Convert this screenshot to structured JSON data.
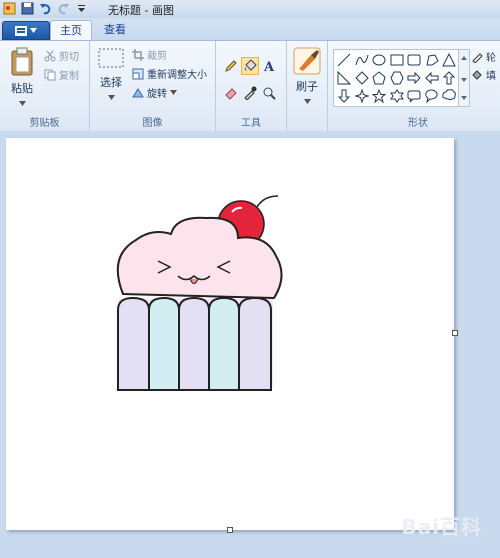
{
  "window": {
    "title": "无标题 - 画图"
  },
  "tabs": {
    "file_icon": "paint-menu-icon",
    "home": "主页",
    "view": "查看"
  },
  "clipboard": {
    "paste": "粘贴",
    "cut": "剪切",
    "copy": "复制",
    "group_label": "剪贴板"
  },
  "image": {
    "select": "选择",
    "crop": "裁剪",
    "resize": "重新调整大小",
    "rotate": "旋转",
    "group_label": "图像"
  },
  "tools": {
    "group_label": "工具"
  },
  "brushes": {
    "label": "刷子"
  },
  "shapes": {
    "group_label": "形状",
    "outline": "轮",
    "fill": "填"
  },
  "watermark": "Bai百科",
  "colors": {
    "accent": "#1e56a8",
    "selected_tool": "#fbe39a"
  }
}
